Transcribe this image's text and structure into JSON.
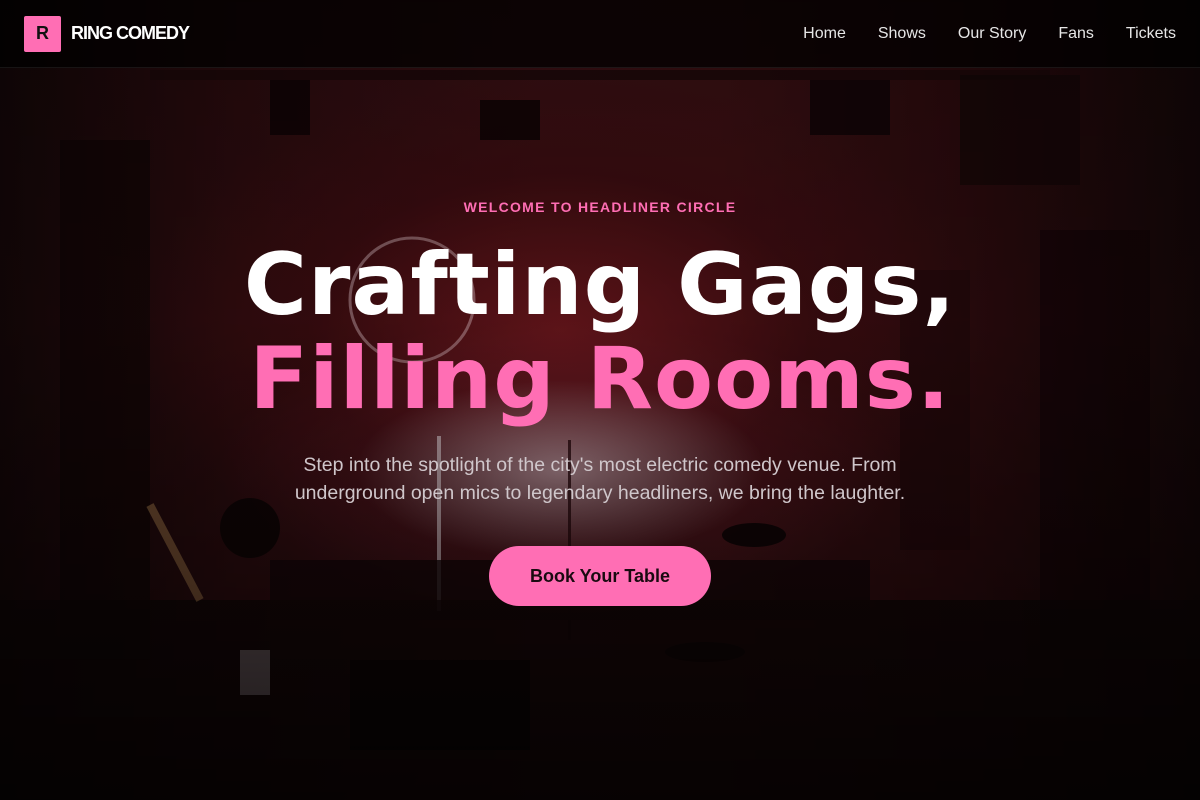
{
  "brand": {
    "mark": "R",
    "name": "RING COMEDY"
  },
  "nav": {
    "items": [
      {
        "label": "Home"
      },
      {
        "label": "Shows"
      },
      {
        "label": "Our Story"
      },
      {
        "label": "Fans"
      },
      {
        "label": "Tickets"
      }
    ]
  },
  "hero": {
    "eyebrow": "WELCOME TO HEADLINER CIRCLE",
    "title_line1": "Crafting Gags,",
    "title_line2": "Filling Rooms.",
    "subtitle": "Step into the spotlight of the city's most electric comedy venue. From underground open mics to legendary headliners, we bring the laughter.",
    "cta_label": "Book Your Table"
  },
  "colors": {
    "accent": "#ff6eb4",
    "nav_bg": "#000000",
    "title": "#ffffff",
    "subtitle": "#cfc6ca"
  }
}
